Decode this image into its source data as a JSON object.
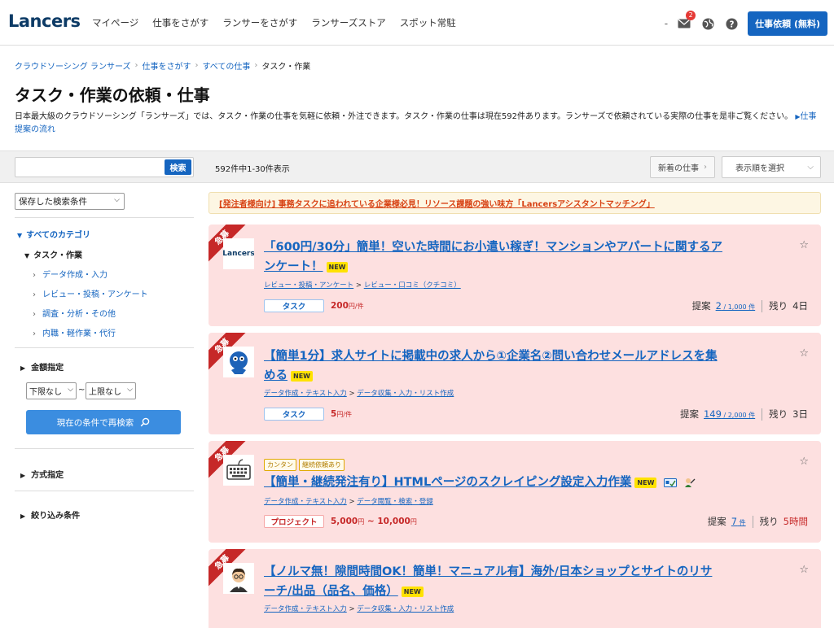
{
  "header": {
    "logo": "Lancers",
    "nav": [
      "マイページ",
      "仕事をさがす",
      "ランサーをさがす",
      "ランサーズストア",
      "スポット常駐"
    ],
    "dash": "-",
    "mail_count": "2",
    "cta": "仕事依頼 (無料)",
    "icons": [
      "mail-icon",
      "globe-icon",
      "help-icon"
    ]
  },
  "breadcrumb": {
    "items": [
      "クラウドソーシング ランサーズ",
      "仕事をさがす",
      "すべての仕事"
    ],
    "current": "タスク・作業"
  },
  "page": {
    "title": "タスク・作業の依頼・仕事",
    "intro": "日本最大級のクラウドソーシング「ランサーズ」では、タスク・作業の仕事を気軽に依頼・外注できます。タスク・作業の仕事は現在592件あります。ランサーズで依頼されている実際の仕事を是非ご覧ください。",
    "intro_link": "仕事提案の流れ"
  },
  "toolbar": {
    "search_placeholder": "",
    "search_button": "検索",
    "count": "592件中1-30件表示",
    "new_jobs": "新着の仕事",
    "sort": "表示順を選択"
  },
  "sidebar": {
    "saved_search": "保存した検索条件",
    "all_categories": "すべてのカテゴリ",
    "current_category": "タスク・作業",
    "subcategories": [
      "データ作成・入力",
      "レビュー・投稿・アンケート",
      "調査・分析・その他",
      "内職・軽作業・代行"
    ],
    "price_heading": "金額指定",
    "min_price": "下限なし",
    "tilde": "~",
    "max_price": "上限なし",
    "research_button": "現在の条件で再検索",
    "method_heading": "方式指定",
    "filter_heading": "絞り込み条件"
  },
  "banner": {
    "text": "[発注者様向け] 事務タスクに追われている企業様必見！リソース課題の強い味方「Lancersアシスタントマッチング」"
  },
  "listings": [
    {
      "ribbon": "急募",
      "thumb_text": "Lancers",
      "title1": "「600円/30分」簡単！空いた時間にお小遣い稼ぎ！マンションやアパートに関するア",
      "title2": "ンケート！",
      "new_label": "NEW",
      "cat1": "レビュー・投稿・アンケート",
      "cat2": "レビュー・口コミ（クチコミ）",
      "type": "タスク",
      "price": "200",
      "price_unit": "円/件",
      "proposal_label": "提案",
      "proposals": "2",
      "proposal_limit": " / 1,000 件",
      "remaining_label": "残り",
      "remaining": "4日"
    },
    {
      "ribbon": "急募",
      "title1": "【簡単1分】求人サイトに掲載中の求人から①企業名②問い合わせメールアドレスを集",
      "title2": "める",
      "new_label": "NEW",
      "cat1": "データ作成・テキスト入力",
      "cat2": "データ収集・入力・リスト作成",
      "type": "タスク",
      "price": "5",
      "price_unit": "円/件",
      "proposal_label": "提案",
      "proposals": "149",
      "proposal_limit": " / 2,000 件",
      "remaining_label": "残り",
      "remaining": "3日"
    },
    {
      "ribbon": "急募",
      "chips": [
        "カンタン",
        "継続依頼あり"
      ],
      "title1": "【簡単・継続発注有り】HTMLページのスクレイピング設定入力作業",
      "new_label": "NEW",
      "cat1": "データ作成・テキスト入力",
      "cat2": "データ閲覧・検索・登録",
      "type": "プロジェクト",
      "price_min": "5,000",
      "price_unit_min": "円",
      "price_sep": " ~ ",
      "price_max": "10,000",
      "price_unit_max": "円",
      "proposal_label": "提案",
      "proposals": "7",
      "proposal_limit": " 件",
      "remaining_label": "残り",
      "remaining": "5時間"
    },
    {
      "ribbon": "急募",
      "title1": "【ノルマ無！隙間時間OK！簡単！マニュアル有】海外/日本ショップとサイトのリサ",
      "title2": "ーチ/出品（品名、価格）",
      "new_label": "NEW",
      "cat1": "データ作成・テキスト入力",
      "cat2": "データ収集・入力・リスト作成"
    }
  ]
}
